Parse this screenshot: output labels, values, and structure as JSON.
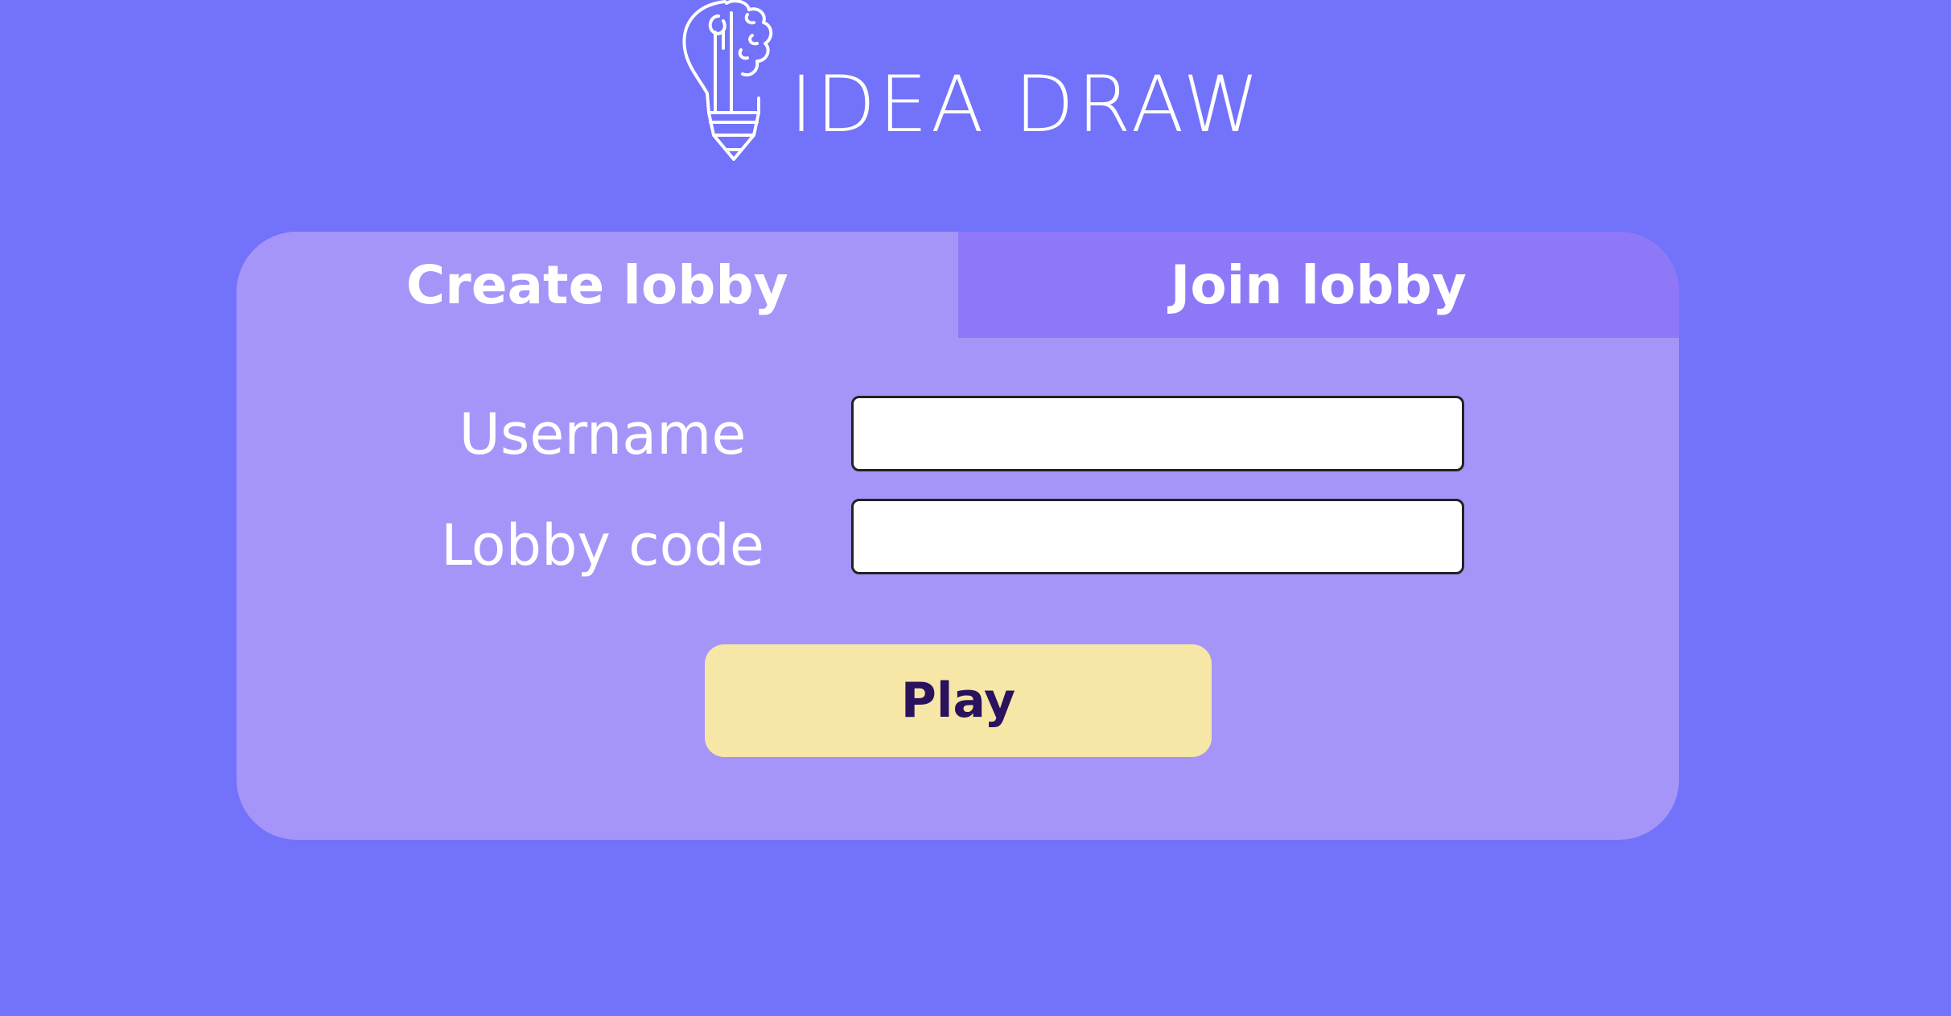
{
  "header": {
    "logo_text": "IDEA DRAW",
    "logo_icon": "lightbulb-pencil-brain-icon"
  },
  "tabs": [
    {
      "label": "Create lobby",
      "active": true
    },
    {
      "label": "Join lobby",
      "active": false
    }
  ],
  "form": {
    "username_label": "Username",
    "username_value": "",
    "lobby_code_label": "Lobby code",
    "lobby_code_value": "",
    "play_label": "Play"
  },
  "colors": {
    "background": "#7272fa",
    "card": "#a595f9",
    "inactive_tab": "#8e78f8",
    "play_button": "#f7e7a6",
    "play_text": "#2a125e"
  }
}
